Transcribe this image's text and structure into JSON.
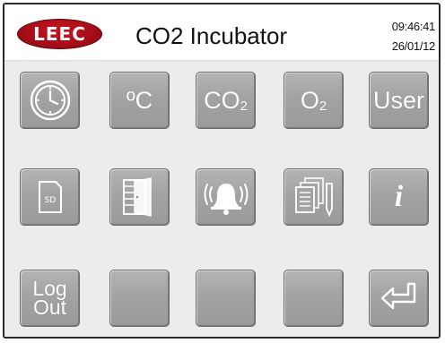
{
  "header": {
    "logo_text": "LEEC",
    "title": "CO2 Incubator",
    "time": "09:46:41",
    "date": "26/01/12"
  },
  "buttons": {
    "temperature_label": "ºC",
    "co2_label_main": "CO",
    "co2_label_sub": "2",
    "o2_label_main": "O",
    "o2_label_sub": "2",
    "user_label": "User",
    "sd_label": "SD",
    "info_label": "i",
    "logout_line1": "Log",
    "logout_line2": "Out"
  },
  "colors": {
    "brand_red": "#b0101a",
    "button_gray": "#a3a3a3"
  }
}
